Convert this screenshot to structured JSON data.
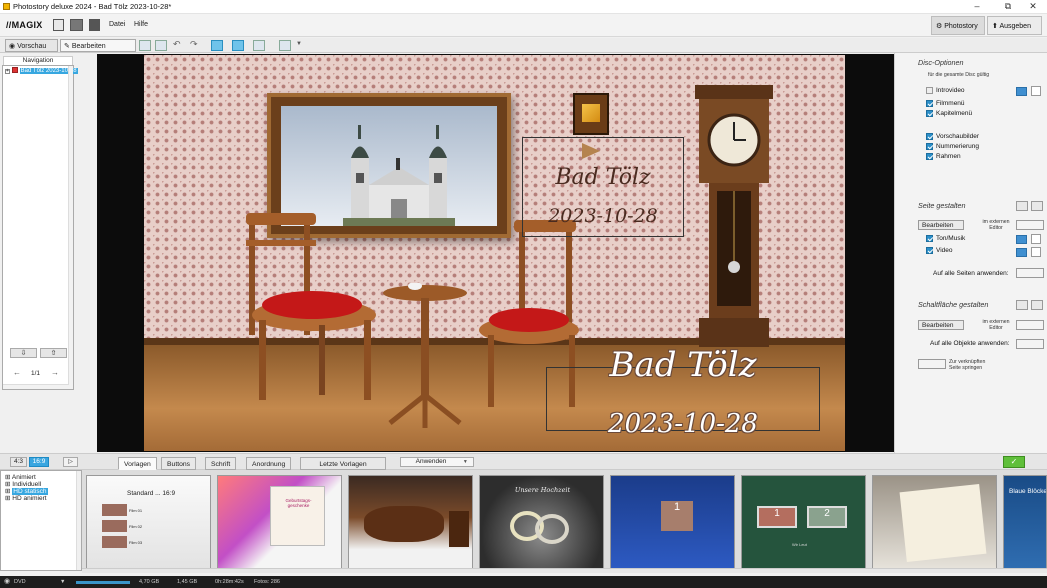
{
  "window": {
    "title": "Photostory deluxe 2024 - Bad Tölz 2023-10-28*"
  },
  "menubar": {
    "logo": "MAGIX",
    "menus": [
      "Datei",
      "Hilfe"
    ],
    "photostory": "Photostory",
    "ausgeben": "Ausgeben"
  },
  "modebar": {
    "vorschau": "Vorschau",
    "bearbeiten": "Bearbeiten"
  },
  "nav": {
    "header": "Navigation",
    "item": "Bad Tölz 2023-10-28",
    "page": "1/1"
  },
  "preview": {
    "caption_title": "Bad Tölz",
    "caption_date": "2023-10-28",
    "big_title": "Bad Tölz",
    "big_date": "2023-10-28"
  },
  "right": {
    "disc_title": "Disc-Optionen",
    "disc_sub": "für die gesamte Disc gültig",
    "introvideo": "Introvideo",
    "filmmenu": "Filmmenü",
    "kapitelmenu": "Kapitelmenü",
    "vorschaubilder": "Vorschaubilder",
    "nummerierung": "Nummerierung",
    "rahmen": "Rahmen",
    "seite_title": "Seite gestalten",
    "bearbeiten": "Bearbeiten",
    "im_ext": "im externen",
    "editor": "Editor",
    "ton": "Ton/Musik",
    "video": "Video",
    "alle_seiten": "Auf alle Seiten anwenden:",
    "schalt_title": "Schaltfläche gestalten",
    "bearbeiten2": "Bearbeiten",
    "im_ext2": "im externen",
    "editor2": "Editor",
    "alle_objekte": "Auf alle Objekte anwenden:",
    "zur_link": "Zur verknüpften",
    "seite_springen": "Seite springen"
  },
  "bottom": {
    "ratio43": "4:3",
    "ratio169": "16:9",
    "tabs": [
      "Vorlagen",
      "Buttons",
      "Schrift",
      "Anordnung"
    ],
    "letzte": "Letzte Vorlagen",
    "anwenden": "Anwenden"
  },
  "templates": [
    "Animiert",
    "Individuell",
    "HD statisch",
    "HD animiert"
  ],
  "thumbs": {
    "t1": "Standard ... 16:9",
    "film1": "Film 01",
    "film2": "Film 02",
    "film3": "Film 03",
    "t2": "Geburtstags-geschenke",
    "t4": "Unsere Hochzeit",
    "t5a": "1",
    "t5b": "2",
    "t6": "Wir Leut",
    "t8": "Blaue Blöcke"
  },
  "status": {
    "dvd": "DVD",
    "size1": "4,70 GB",
    "size2": "1,45 GB",
    "time": "0h:28m:42s",
    "fotos": "Fotos: 286"
  }
}
